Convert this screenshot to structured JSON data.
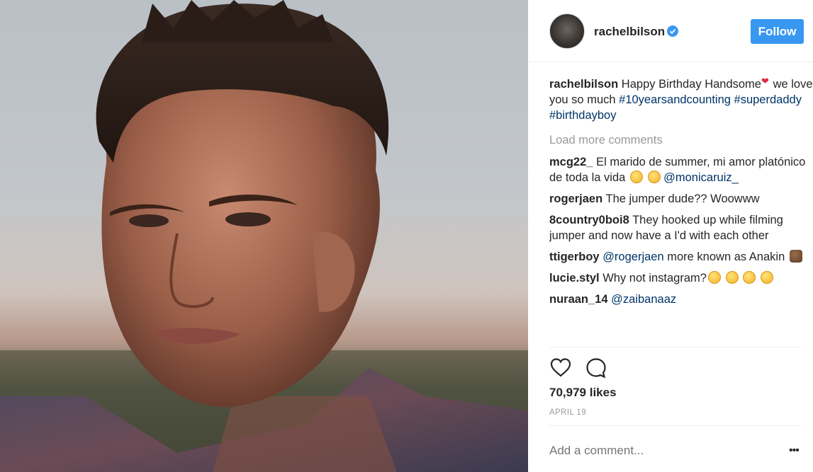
{
  "post": {
    "username": "rachelbilson",
    "follow_label": "Follow",
    "caption": {
      "user": "rachelbilson",
      "text": "Happy Birthday Handsome",
      "text_after": " we love you so much ",
      "tags": [
        "#10yearsandcounting",
        "#superdaddy",
        "#birthdayboy"
      ]
    },
    "load_more": "Load more comments",
    "comments": [
      {
        "user": "mcg22_",
        "text": "El marido de summer, mi amor platónico de toda la vida",
        "mention": "@monicaruiz_"
      },
      {
        "user": "rogerjaen",
        "text": "The jumper dude?? Woowww"
      },
      {
        "user": "8country0boi8",
        "text": "They hooked up while filming jumper and now have a I'd with each other"
      },
      {
        "user": "ttigerboy",
        "mention": "@rogerjaen",
        "text": "more known as Anakin"
      },
      {
        "user": "lucie.styl",
        "text": "Why not instagram?"
      },
      {
        "user": "nuraan_14",
        "mention": "@zaibanaaz"
      }
    ],
    "likes": "70,979 likes",
    "date": "APRIL 19",
    "add_comment_placeholder": "Add a comment...",
    "more_label": "•••"
  },
  "icons": {
    "verified": "verified-badge-icon",
    "like": "heart-icon",
    "comment": "comment-bubble-icon"
  },
  "colors": {
    "follow_bg": "#3897f0",
    "link": "#003569",
    "muted": "#999999"
  }
}
